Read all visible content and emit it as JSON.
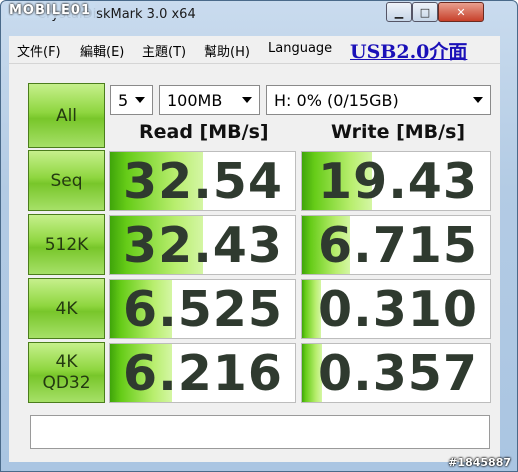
{
  "window": {
    "title": "CrystalDiskMark 3.0 x64",
    "watermark_logo": "MOBILE01",
    "controls": {
      "minimize": "▁",
      "maximize": "□",
      "close": "✕"
    }
  },
  "menu": {
    "items": [
      "文件(F)",
      "編輯(E)",
      "主題(T)",
      "幫助(H)",
      "Language"
    ],
    "annotation": "USB2.0介面"
  },
  "controls": {
    "all_label": "All",
    "count_value": "5",
    "size_value": "100MB",
    "drive_value": "H: 0% (0/15GB)"
  },
  "headers": {
    "read": "Read [MB/s]",
    "write": "Write [MB/s]"
  },
  "rows": [
    {
      "label": "Seq",
      "read": "32.54",
      "write": "19.43"
    },
    {
      "label": "512K",
      "read": "32.43",
      "write": "6.715"
    },
    {
      "label": "4K",
      "read": "6.525",
      "write": "0.310"
    },
    {
      "label": "4K\nQD32",
      "read": "6.216",
      "write": "0.357"
    }
  ],
  "comment": "",
  "footer_watermark": "#1845887",
  "colors": {
    "button_green": "#8fd640",
    "bar_green": "#66cc18",
    "annotation_blue": "#1a10b8"
  }
}
